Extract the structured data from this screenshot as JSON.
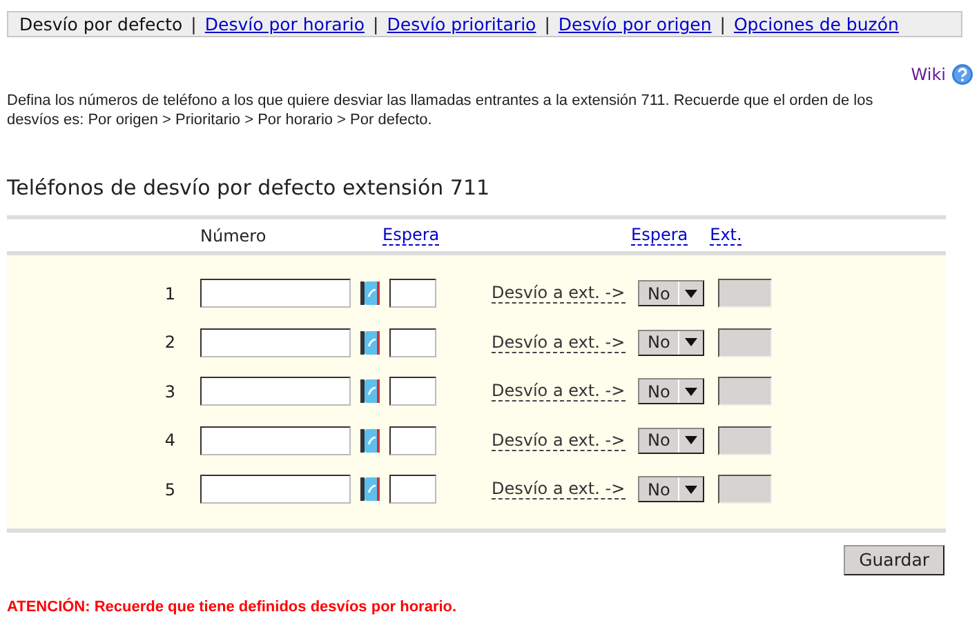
{
  "tabs": [
    {
      "label": "Desvío por defecto",
      "selected": true
    },
    {
      "label": "Desvío por horario",
      "selected": false
    },
    {
      "label": "Desvío prioritario",
      "selected": false
    },
    {
      "label": "Desvío por origen",
      "selected": false
    },
    {
      "label": "Opciones de buzón",
      "selected": false
    }
  ],
  "tab_separator": "|",
  "wiki_link": "Wiki",
  "description": "Defina los números de teléfono a los que quiere desviar las llamadas entrantes a la extensión 711. Recuerde que el orden de los desvíos es: Por origen > Prioritario > Por horario > Por defecto.",
  "heading": "Teléfonos de desvío por defecto extensión 711",
  "table": {
    "columns": {
      "number": "Número",
      "wait": "Espera",
      "wait_2": "Espera",
      "ext": "Ext."
    },
    "rows": [
      {
        "index": "1",
        "redirect_label": "Desvío a ext. ->",
        "select": "No",
        "ext_disabled": true
      },
      {
        "index": "2",
        "redirect_label": "Desvío a ext. ->",
        "select": "No",
        "ext_disabled": true
      },
      {
        "index": "3",
        "redirect_label": "Desvío a ext. ->",
        "select": "No",
        "ext_disabled": true
      },
      {
        "index": "4",
        "redirect_label": "Desvío a ext. ->",
        "select": "No",
        "ext_disabled": true
      },
      {
        "index": "5",
        "redirect_label": "Desvío a ext. ->",
        "select": "No",
        "ext_disabled": true
      }
    ]
  },
  "save_button": "Guardar",
  "warning": "ATENCIÓN: Recuerde que tiene definidos desvíos por horario."
}
